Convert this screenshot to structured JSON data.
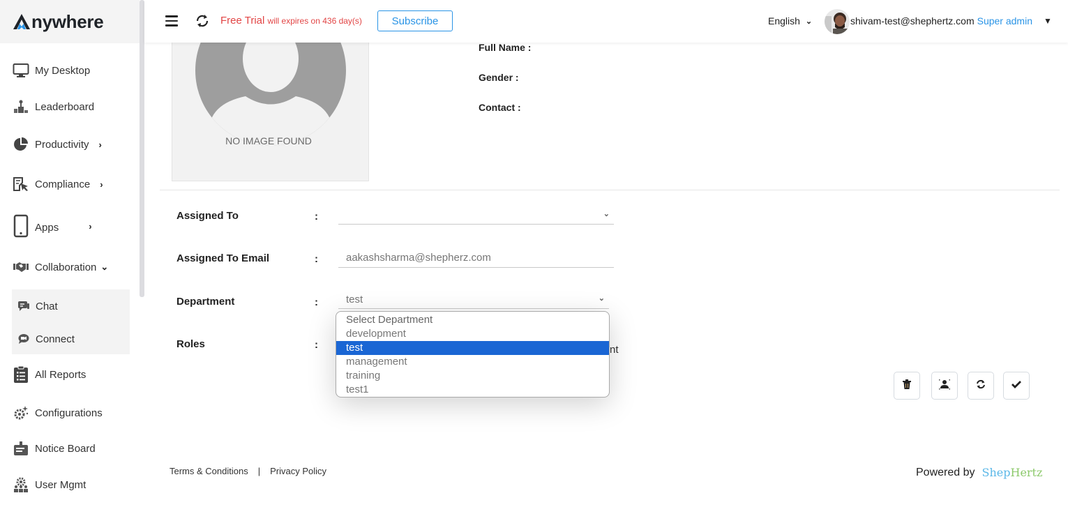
{
  "app": {
    "logo_text": "nywhere",
    "logo_letter": "A"
  },
  "header": {
    "trial_label": "Free Trial",
    "trial_note": "will expires on 436 day(s)",
    "subscribe_label": "Subscribe",
    "language": "English",
    "user_email": "shivam-test@shephertz.com",
    "user_role": "Super admin"
  },
  "sidebar": {
    "items": [
      {
        "label": "My Desktop",
        "icon": "monitor-icon"
      },
      {
        "label": "Leaderboard",
        "icon": "leaderboard-icon"
      },
      {
        "label": "Productivity",
        "icon": "pie-chart-icon",
        "chevron": "›"
      },
      {
        "label": "Compliance",
        "icon": "compliance-icon",
        "chevron": "›"
      },
      {
        "label": "Apps",
        "icon": "mobile-icon",
        "chevron": "›"
      },
      {
        "label": "Collaboration",
        "icon": "handshake-icon",
        "chevron": "⌄"
      },
      {
        "label": "All Reports",
        "icon": "clipboard-list-icon"
      },
      {
        "label": "Configurations",
        "icon": "gears-icon"
      },
      {
        "label": "Notice Board",
        "icon": "notice-board-icon"
      },
      {
        "label": "User Mgmt",
        "icon": "user-group-icon"
      }
    ],
    "sub_items": [
      {
        "label": "Chat",
        "icon": "chat-icon"
      },
      {
        "label": "Connect",
        "icon": "video-chat-icon"
      }
    ]
  },
  "profile": {
    "no_image_text": "NO IMAGE FOUND",
    "full_name_label": "Full Name :",
    "gender_label": "Gender :",
    "contact_label": "Contact :"
  },
  "form": {
    "colon": ":",
    "assigned_to": {
      "label": "Assigned To",
      "value": ""
    },
    "assigned_to_email": {
      "label": "Assigned To Email",
      "value": "aakashsharma@shepherz.com"
    },
    "department": {
      "label": "Department",
      "value": "test"
    },
    "roles": {
      "label": "Roles",
      "value_peek": "nt"
    }
  },
  "department_dropdown": {
    "options": [
      "Select Department",
      "development",
      "test",
      "management",
      "training",
      "test1"
    ],
    "selected": "test"
  },
  "actions": [
    {
      "name": "delete",
      "icon": "trash-icon"
    },
    {
      "name": "face-recognition",
      "icon": "face-scan-icon"
    },
    {
      "name": "refresh",
      "icon": "refresh-icon"
    },
    {
      "name": "save",
      "icon": "check-icon"
    }
  ],
  "footer": {
    "terms": "Terms & Conditions",
    "separator": "|",
    "privacy": "Privacy Policy",
    "powered_by": "Powered by",
    "brand_part1": "Shep",
    "brand_part2": "Hertz"
  },
  "colors": {
    "accent": "#2a94e6",
    "trial_red": "#e24545",
    "selected_option": "#1a66d4",
    "sidebar_bg": "#f4f4f4"
  }
}
